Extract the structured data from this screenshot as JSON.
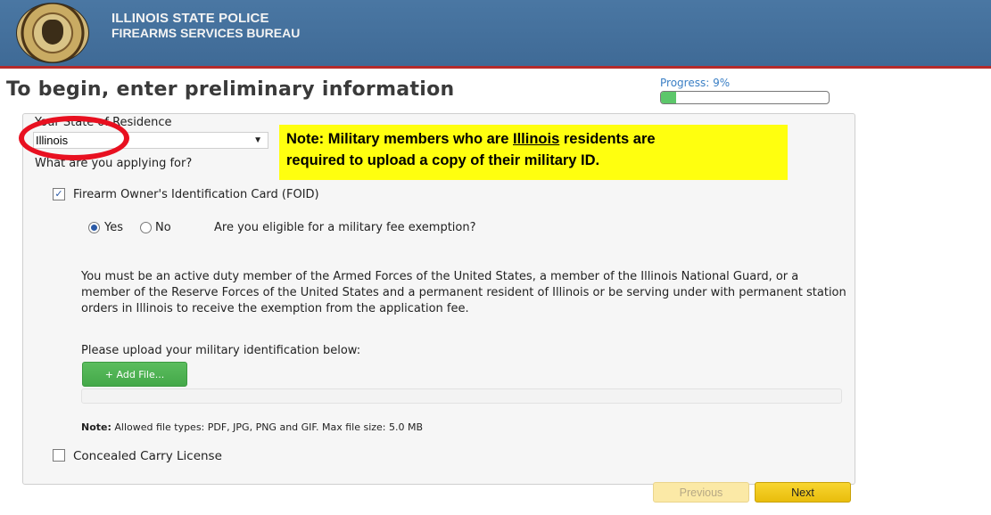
{
  "header": {
    "org_name": "Illinois State Police",
    "bureau": "Firearms Services Bureau",
    "seal_icon": "illinois-state-police-seal",
    "bar_color": "#4a77a3",
    "rule_color": "#b52a2a"
  },
  "page": {
    "title": "To begin, enter preliminary information",
    "progress_label": "Progress: 9%",
    "progress_value": 0.09
  },
  "form": {
    "state_label": "Your State of Residence",
    "state_value": "Illinois",
    "applying_label": "What are you applying for?",
    "foid_label": "Firearm Owner's Identification Card (FOID)",
    "foid_checked": true,
    "military_yes": "Yes",
    "military_no": "No",
    "military_question": "Are you eligible for a military fee exemption?",
    "military_selected": "Yes",
    "exemption_text": "You must be an active duty member of the Armed Forces of the United States, a member of the Illinois National Guard, or a member of the Reserve Forces of the United States and a permanent resident of Illinois or be serving under with permanent station orders in Illinois to receive the exemption from the application fee.",
    "upload_label": "Please upload your military identification below:",
    "add_file_label": "+ Add File...",
    "file_note_prefix": "Note:",
    "file_note": "Allowed file types: PDF, JPG, PNG and GIF. Max file size: 5.0 MB",
    "ccl_label": "Concealed Carry License",
    "ccl_checked": false
  },
  "callout": {
    "line1_before": "Note: Military members who are ",
    "line1_link": "Illinois",
    "line1_after": " residents are",
    "line2": "required to upload a copy of their military ID.",
    "highlight_color": "#ffff0f",
    "circle_color": "#e81020"
  },
  "nav": {
    "previous_label": "Previous",
    "next_label": "Next"
  }
}
